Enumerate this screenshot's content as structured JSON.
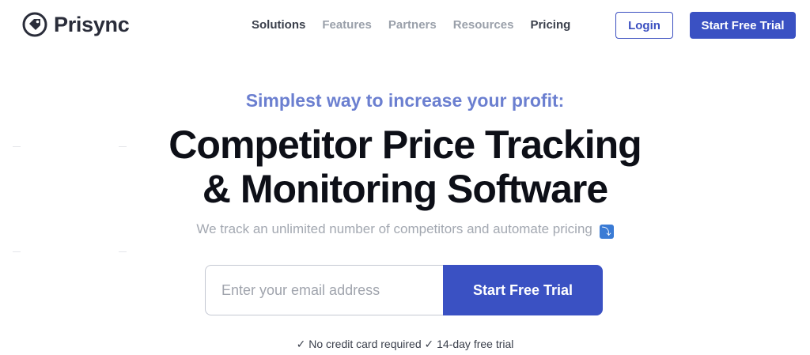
{
  "brand": {
    "name": "Prisync",
    "logo_icon": "price-tag-logo-icon"
  },
  "nav": [
    {
      "label": "Solutions",
      "style": "dark"
    },
    {
      "label": "Features",
      "style": "muted"
    },
    {
      "label": "Partners",
      "style": "muted"
    },
    {
      "label": "Resources",
      "style": "muted"
    },
    {
      "label": "Pricing",
      "style": "dark"
    }
  ],
  "header": {
    "login_label": "Login",
    "trial_label": "Start Free Trial"
  },
  "hero": {
    "tagline": "Simplest way to increase your profit:",
    "title_line1": "Competitor Price Tracking",
    "title_line2": "& Monitoring Software",
    "subtitle": "We track an unlimited number of competitors and automate pricing",
    "subtitle_icon": "curved-arrow-down-icon"
  },
  "signup": {
    "email_placeholder": "Enter your email address",
    "email_value": "",
    "button_label": "Start Free Trial"
  },
  "notes": "✓ No credit card required ✓ 14-day free trial",
  "colors": {
    "accent": "#3a51c3",
    "tagline": "#6b7fd0",
    "title": "#0d0f17"
  }
}
